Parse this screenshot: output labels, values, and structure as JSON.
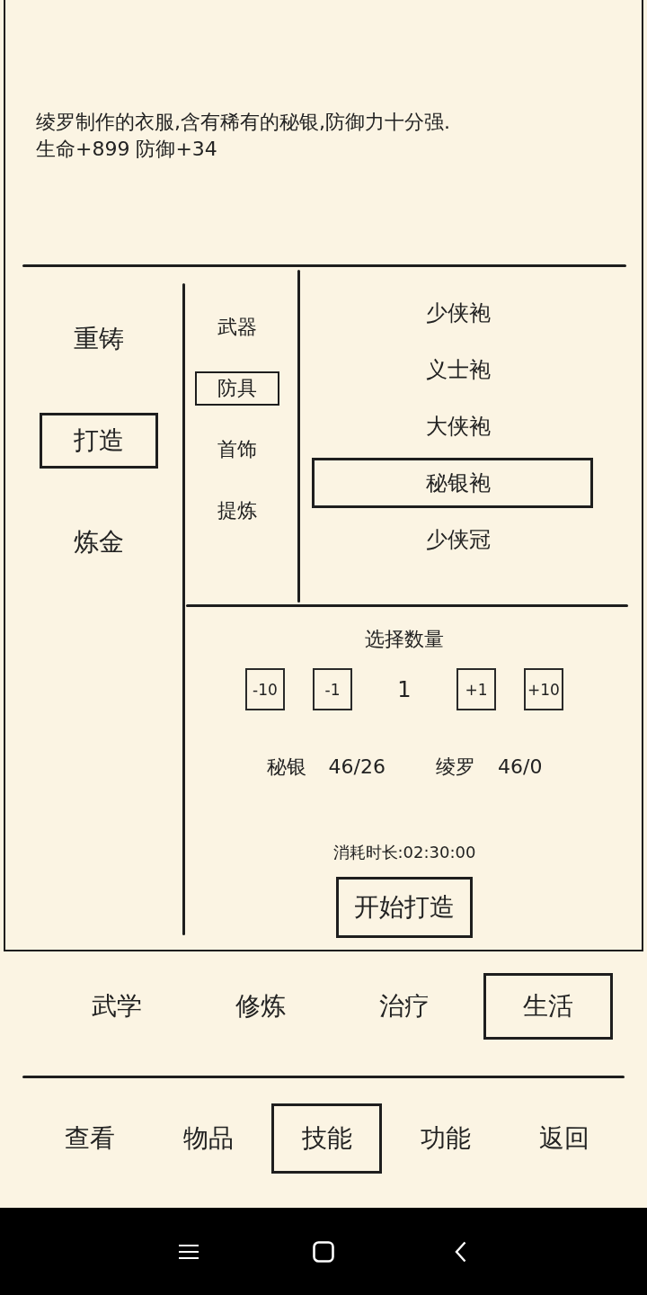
{
  "item_detail": {
    "description": "绫罗制作的衣服,含有稀有的秘银,防御力十分强.",
    "stats": "生命+899 防御+34"
  },
  "crafting_modes": [
    {
      "label": "重铸",
      "selected": false
    },
    {
      "label": "打造",
      "selected": true
    },
    {
      "label": "炼金",
      "selected": false
    }
  ],
  "equipment_categories": [
    {
      "label": "武器",
      "selected": false
    },
    {
      "label": "防具",
      "selected": true
    },
    {
      "label": "首饰",
      "selected": false
    },
    {
      "label": "提炼",
      "selected": false
    }
  ],
  "recipes": [
    {
      "label": "少侠袍",
      "selected": false
    },
    {
      "label": "义士袍",
      "selected": false
    },
    {
      "label": "大侠袍",
      "selected": false
    },
    {
      "label": "秘银袍",
      "selected": true
    },
    {
      "label": "少侠冠",
      "selected": false
    }
  ],
  "quantity": {
    "title": "选择数量",
    "decrease_buttons": [
      "-10",
      "-1"
    ],
    "value": "1",
    "increase_buttons": [
      "+1",
      "+10"
    ]
  },
  "materials": [
    {
      "name": "秘银",
      "amount": "46/26"
    },
    {
      "name": "绫罗",
      "amount": "46/0"
    }
  ],
  "duration": "消耗时长:02:30:00",
  "start_button": "开始打造",
  "skill_tabs": [
    {
      "label": "武学",
      "selected": false
    },
    {
      "label": "修炼",
      "selected": false
    },
    {
      "label": "治疗",
      "selected": false
    },
    {
      "label": "生活",
      "selected": true
    }
  ],
  "bottom_tabs": [
    {
      "label": "查看",
      "selected": false
    },
    {
      "label": "物品",
      "selected": false
    },
    {
      "label": "技能",
      "selected": true
    },
    {
      "label": "功能",
      "selected": false
    },
    {
      "label": "返回",
      "selected": false
    }
  ]
}
